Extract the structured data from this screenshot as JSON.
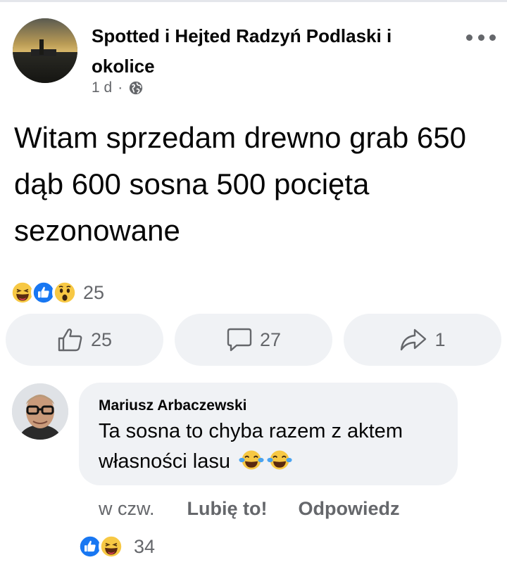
{
  "post": {
    "page_name": "Spotted i Hejted Radzyń Podlaski i okolice",
    "time": "1 d",
    "separator": "·",
    "privacy_icon": "globe-icon",
    "text": "Witam sprzedam drewno grab 650 dąb 600 sosna 500 pocięta sezonowane"
  },
  "reactions": {
    "icons": [
      "laugh-emoji-icon",
      "like-reaction-icon",
      "wow-emoji-icon"
    ],
    "count": "25"
  },
  "actions": {
    "like_count": "25",
    "comment_count": "27",
    "share_count": "1"
  },
  "comment": {
    "author": "Mariusz Arbaczewski",
    "text": "Ta sosna to chyba razem z aktem własności lasu",
    "emojis": [
      "tears-of-joy-emoji-icon",
      "tears-of-joy-emoji-icon"
    ],
    "time": "w czw.",
    "like_label": "Lubię to!",
    "reply_label": "Odpowiedz",
    "reactions": {
      "icons": [
        "like-reaction-icon",
        "laugh-emoji-icon"
      ],
      "count": "34"
    }
  },
  "colors": {
    "primary_text": "#050505",
    "secondary_text": "#65676b",
    "surface": "#f0f2f5",
    "like_blue": "#1877f2",
    "emoji_yellow": "#f7c844"
  }
}
